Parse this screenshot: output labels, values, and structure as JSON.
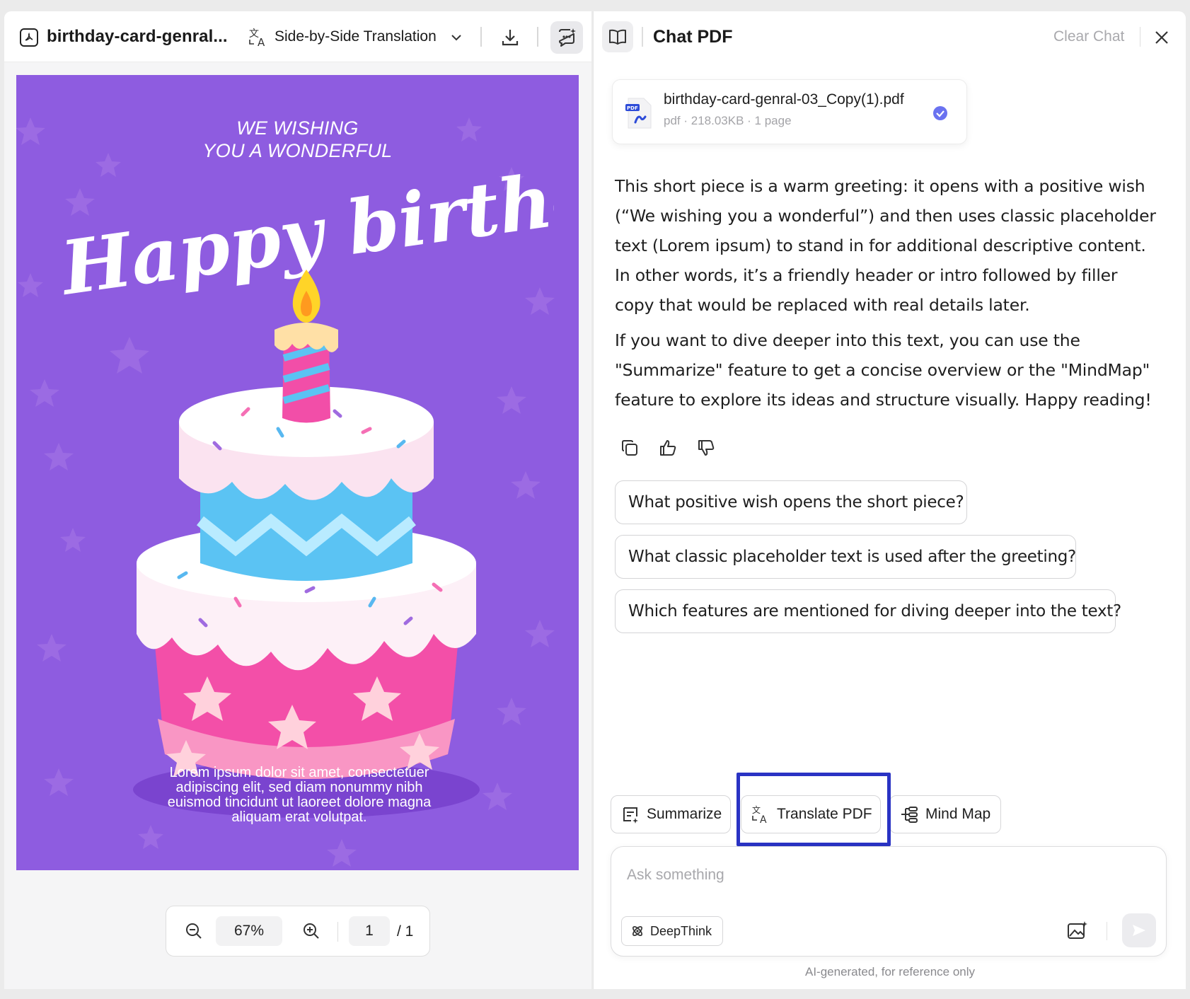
{
  "viewer": {
    "file_name": "birthday-card-genral...",
    "translate_mode": "Side-by-Side Translation",
    "zoom": "67%",
    "page_current": "1",
    "page_total": "/ 1"
  },
  "card": {
    "subtitle_line1": "WE WISHING",
    "subtitle_line2": "YOU A WONDERFUL",
    "headline": "Happy birthday",
    "body": "Lorem ipsum dolor sit amet, consectetuer adipiscing elit, sed diam nonummy nibh euismod tincidunt ut laoreet dolore magna aliquam erat volutpat.",
    "background_color": "#8e5ce0"
  },
  "chat": {
    "title": "Chat PDF",
    "clear_label": "Clear Chat",
    "file": {
      "name": "birthday-card-genral-03_Copy(1).pdf",
      "meta": "pdf · 218.03KB · 1 page",
      "icon_label": "PDF"
    },
    "answer_p1": "This short piece is a warm greeting: it opens with a positive wish (“We wishing you a wonderful”) and then uses classic placeholder text (Lorem ipsum) to stand in for additional descriptive content. In other words, it’s a friendly header or intro followed by filler copy that would be replaced with real details later.",
    "answer_p2": "If you want to dive deeper into this text, you can use the \"Summarize\" feature to get a concise overview or the \"MindMap\" feature to explore its ideas and structure visually. Happy reading!",
    "suggestions": [
      "What positive wish opens the short piece?",
      "What classic placeholder text is used after the greeting?",
      "Which features are mentioned for diving deeper into the text?"
    ],
    "tools": {
      "summarize": "Summarize",
      "translate": "Translate PDF",
      "mindmap": "Mind Map"
    },
    "ask_placeholder": "Ask something",
    "deepthink_label": "DeepThink",
    "disclaimer": "AI-generated, for reference only",
    "accent_color": "#2a33c4",
    "check_color": "#6a72f0"
  }
}
